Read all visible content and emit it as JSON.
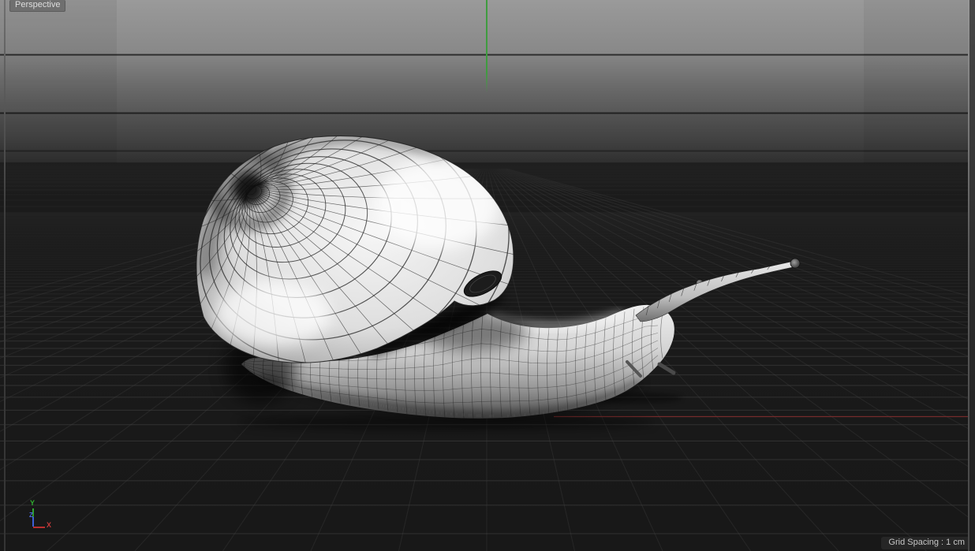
{
  "viewport": {
    "camera_label": "Perspective"
  },
  "hud": {
    "grid_spacing": "Grid Spacing : 1 cm"
  },
  "axis_gizmo": {
    "x_label": "X",
    "y_label": "Y",
    "z_label": "Z"
  },
  "scene": {
    "model": "snail-wireframe-mesh",
    "colors": {
      "axis_x_world": "#7a2c2c",
      "axis_y_world": "#3f9c3f",
      "gizmo_x": "#b83030",
      "gizmo_y": "#2fae2f",
      "gizmo_z": "#3c5fd6",
      "grid_line": "#4a4a4a",
      "grid_diagonal": "#454545",
      "floor_bg": "#1b1b1b",
      "backdrop_top": "#9a9a9a",
      "backdrop_bottom": "#2f2f2f",
      "wireframe": "#1d1d1d",
      "surface_light": "#f4f4f4",
      "surface_dark": "#4f4f4f"
    }
  }
}
